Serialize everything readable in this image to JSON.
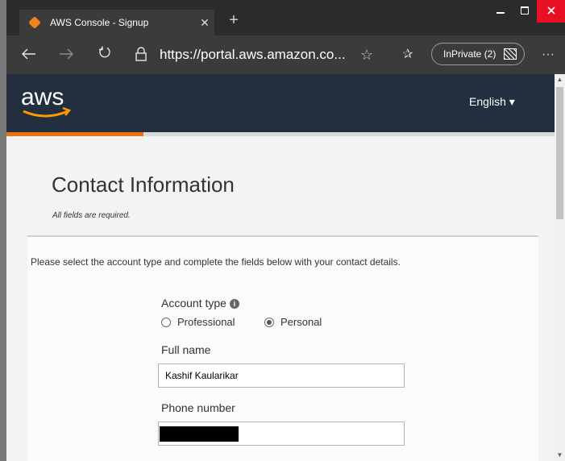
{
  "browser": {
    "tab_title": "AWS Console - Signup",
    "tab_close": "✕",
    "new_tab": "+",
    "url": "https://portal.aws.amazon.co...",
    "inprivate_label": "InPrivate (2)",
    "more": "···"
  },
  "aws_header": {
    "logo_text": "aws",
    "language": "English ▾"
  },
  "signup": {
    "progress_fraction": 0.25,
    "title": "Contact Information",
    "required_note": "All fields are required.",
    "instructions": "Please select the account type and complete the fields below with your contact details.",
    "account_type_label": "Account type",
    "account_types": [
      {
        "label": "Professional",
        "selected": false
      },
      {
        "label": "Personal",
        "selected": true
      }
    ],
    "full_name_label": "Full name",
    "full_name_value": "Kashif Kaularikar",
    "phone_label": "Phone number",
    "phone_value": ""
  },
  "colors": {
    "aws_navy": "#232f3e",
    "aws_orange": "#ec7211",
    "page_bg": "#f2f3f3"
  }
}
